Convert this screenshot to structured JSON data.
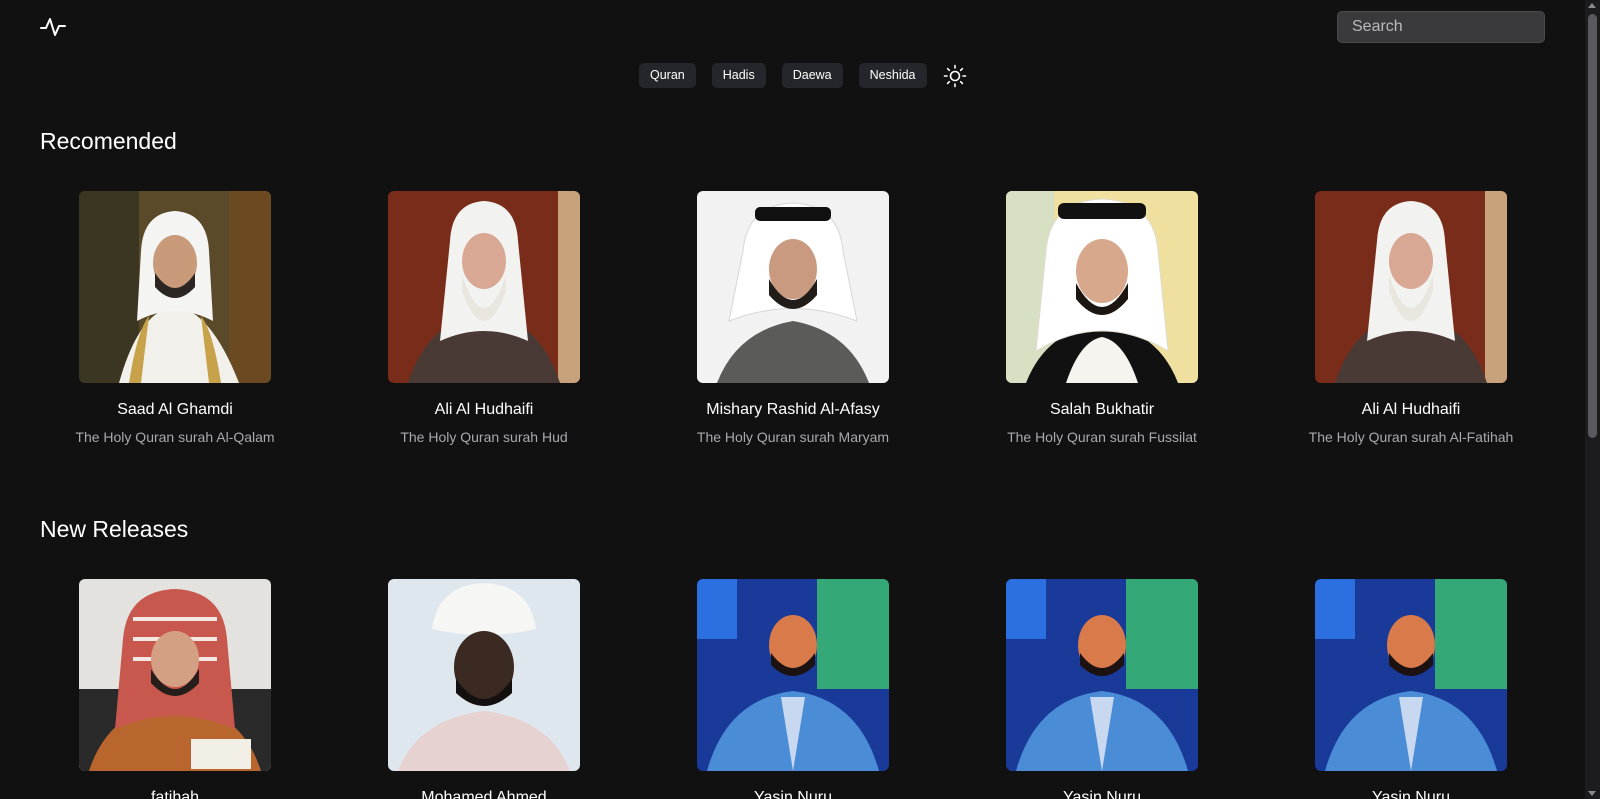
{
  "search": {
    "placeholder": "Search"
  },
  "nav": {
    "items": [
      "Quran",
      "Hadis",
      "Daewa",
      "Neshida"
    ]
  },
  "sections": {
    "recommended": {
      "title": "Recomended",
      "cards": [
        {
          "title": "Saad Al Ghamdi",
          "subtitle": "The Holy Quran surah Al-Qalam"
        },
        {
          "title": "Ali Al Hudhaifi",
          "subtitle": "The Holy Quran surah Hud"
        },
        {
          "title": "Mishary Rashid Al-Afasy",
          "subtitle": "The Holy Quran surah Maryam"
        },
        {
          "title": "Salah Bukhatir",
          "subtitle": "The Holy Quran surah Fussilat"
        },
        {
          "title": "Ali Al Hudhaifi",
          "subtitle": "The Holy Quran surah Al-Fatihah"
        }
      ]
    },
    "new_releases": {
      "title": "New Releases",
      "cards": [
        {
          "title": "fatihah"
        },
        {
          "title": "Mohamed Ahmed"
        },
        {
          "title": "Yasin Nuru"
        },
        {
          "title": "Yasin Nuru"
        },
        {
          "title": "Yasin Nuru"
        }
      ]
    }
  },
  "colors": {
    "background": "#111112",
    "nav_button": "#25262b",
    "search_bg": "#3a3a3d",
    "subtitle": "#a9a9ae"
  }
}
